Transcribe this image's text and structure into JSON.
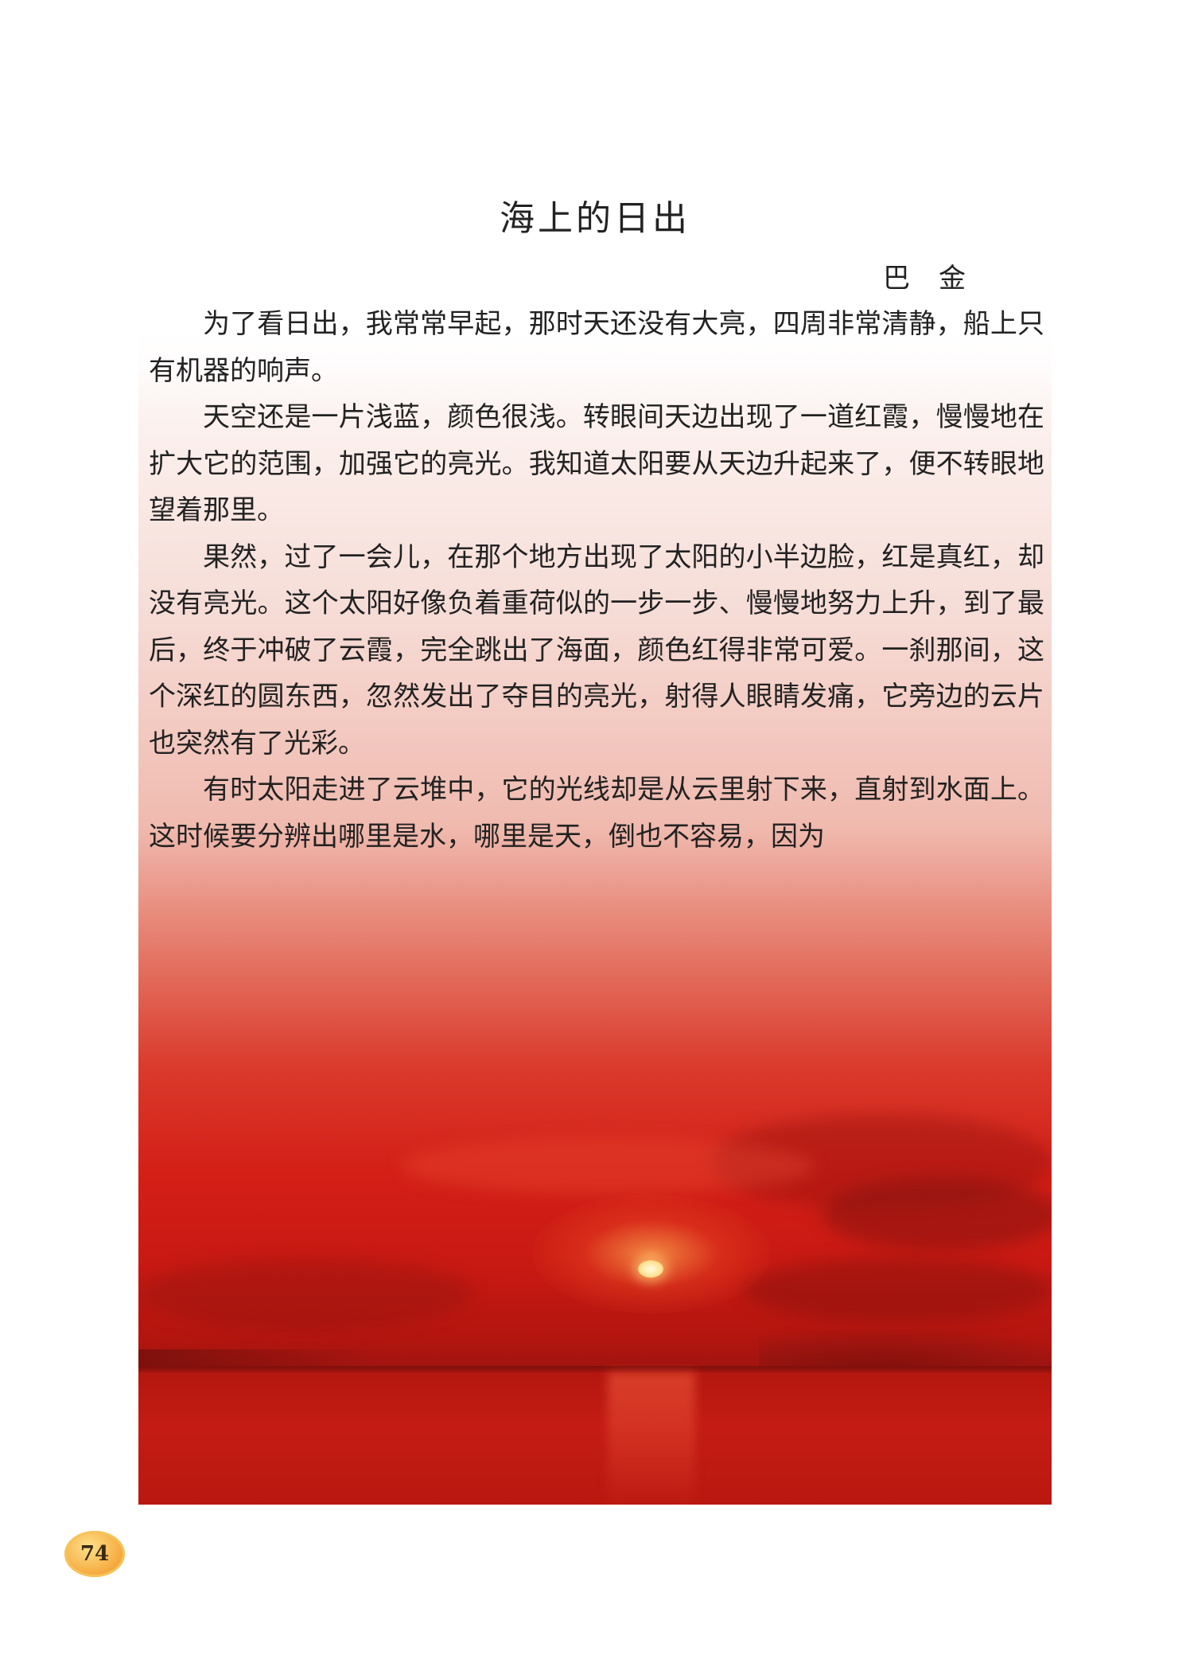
{
  "title": "海上的日出",
  "author": "巴金",
  "paragraphs": [
    "为了看日出，我常常早起，那时天还没有大亮，四周非常清静，船上只有机器的响声。",
    "天空还是一片浅蓝，颜色很浅。转眼间天边出现了一道红霞，慢慢地在扩大它的范围，加强它的亮光。我知道太阳要从天边升起来了，便不转眼地望着那里。",
    "果然，过了一会儿，在那个地方出现了太阳的小半边脸，红是真红，却没有亮光。这个太阳好像负着重荷似的一步一步、慢慢地努力上升，到了最后，终于冲破了云霞，完全跳出了海面，颜色红得非常可爱。一刹那间，这个深红的圆东西，忽然发出了夺目的亮光，射得人眼睛发痛，它旁边的云片也突然有了光彩。",
    "有时太阳走进了云堆中，它的光线却是从云里射下来，直射到水面上。这时候要分辨出哪里是水，哪里是天，倒也不容易，因为"
  ],
  "page_number": "74",
  "colors": {
    "sky_red": "#d41f17",
    "sea_red": "#c41c14",
    "sun": "#ffe49a",
    "badge": "#f7b34a"
  }
}
